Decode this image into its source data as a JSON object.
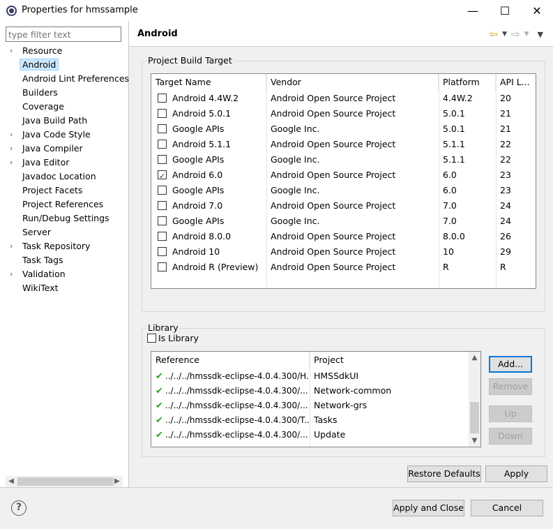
{
  "window": {
    "title": "Properties for hmssample",
    "minimize": "—",
    "maximize": "☐",
    "close": "✕"
  },
  "filter": {
    "placeholder": "type filter text"
  },
  "tree": [
    {
      "label": "Resource",
      "expandable": true
    },
    {
      "label": "Android",
      "expandable": false,
      "selected": true
    },
    {
      "label": "Android Lint Preferences",
      "expandable": false
    },
    {
      "label": "Builders",
      "expandable": false
    },
    {
      "label": "Coverage",
      "expandable": false
    },
    {
      "label": "Java Build Path",
      "expandable": false
    },
    {
      "label": "Java Code Style",
      "expandable": true
    },
    {
      "label": "Java Compiler",
      "expandable": true
    },
    {
      "label": "Java Editor",
      "expandable": true
    },
    {
      "label": "Javadoc Location",
      "expandable": false
    },
    {
      "label": "Project Facets",
      "expandable": false
    },
    {
      "label": "Project References",
      "expandable": false
    },
    {
      "label": "Run/Debug Settings",
      "expandable": false
    },
    {
      "label": "Server",
      "expandable": false
    },
    {
      "label": "Task Repository",
      "expandable": true
    },
    {
      "label": "Task Tags",
      "expandable": false
    },
    {
      "label": "Validation",
      "expandable": true
    },
    {
      "label": "WikiText",
      "expandable": false
    }
  ],
  "page": {
    "title": "Android"
  },
  "build_target": {
    "group_label": "Project Build Target",
    "headers": [
      "Target Name",
      "Vendor",
      "Platform",
      "API L..."
    ],
    "rows": [
      {
        "checked": false,
        "name": "Android 4.4W.2",
        "vendor": "Android Open Source Project",
        "platform": "4.4W.2",
        "api": "20"
      },
      {
        "checked": false,
        "name": "Android 5.0.1",
        "vendor": "Android Open Source Project",
        "platform": "5.0.1",
        "api": "21"
      },
      {
        "checked": false,
        "name": "Google APIs",
        "vendor": "Google Inc.",
        "platform": "5.0.1",
        "api": "21"
      },
      {
        "checked": false,
        "name": "Android 5.1.1",
        "vendor": "Android Open Source Project",
        "platform": "5.1.1",
        "api": "22"
      },
      {
        "checked": false,
        "name": "Google APIs",
        "vendor": "Google Inc.",
        "platform": "5.1.1",
        "api": "22"
      },
      {
        "checked": true,
        "name": "Android 6.0",
        "vendor": "Android Open Source Project",
        "platform": "6.0",
        "api": "23"
      },
      {
        "checked": false,
        "name": "Google APIs",
        "vendor": "Google Inc.",
        "platform": "6.0",
        "api": "23"
      },
      {
        "checked": false,
        "name": "Android 7.0",
        "vendor": "Android Open Source Project",
        "platform": "7.0",
        "api": "24"
      },
      {
        "checked": false,
        "name": "Google APIs",
        "vendor": "Google Inc.",
        "platform": "7.0",
        "api": "24"
      },
      {
        "checked": false,
        "name": "Android 8.0.0",
        "vendor": "Android Open Source Project",
        "platform": "8.0.0",
        "api": "26"
      },
      {
        "checked": false,
        "name": "Android 10",
        "vendor": "Android Open Source Project",
        "platform": "10",
        "api": "29"
      },
      {
        "checked": false,
        "name": "Android R (Preview)",
        "vendor": "Android Open Source Project",
        "platform": "R",
        "api": "R"
      }
    ]
  },
  "library": {
    "group_label": "Library",
    "is_library_label": "Is Library",
    "is_library_checked": false,
    "headers": [
      "Reference",
      "Project"
    ],
    "rows": [
      {
        "reference": "../../../hmssdk-eclipse-4.0.4.300/H...",
        "project": "HMSSdkUI"
      },
      {
        "reference": "../../../hmssdk-eclipse-4.0.4.300/...",
        "project": "Network-common"
      },
      {
        "reference": "../../../hmssdk-eclipse-4.0.4.300/...",
        "project": "Network-grs"
      },
      {
        "reference": "../../../hmssdk-eclipse-4.0.4.300/T...",
        "project": "Tasks"
      },
      {
        "reference": "../../../hmssdk-eclipse-4.0.4.300/...",
        "project": "Update"
      }
    ],
    "buttons": {
      "add": "Add...",
      "remove": "Remove",
      "up": "Up",
      "down": "Down"
    }
  },
  "actions": {
    "restore_defaults": "Restore Defaults",
    "apply": "Apply",
    "apply_and_close": "Apply and Close",
    "cancel": "Cancel",
    "help": "?"
  },
  "colors": {
    "selection": "#cce8ff",
    "check_green": "#2aa12a",
    "default_button_border": "#0078d7"
  }
}
